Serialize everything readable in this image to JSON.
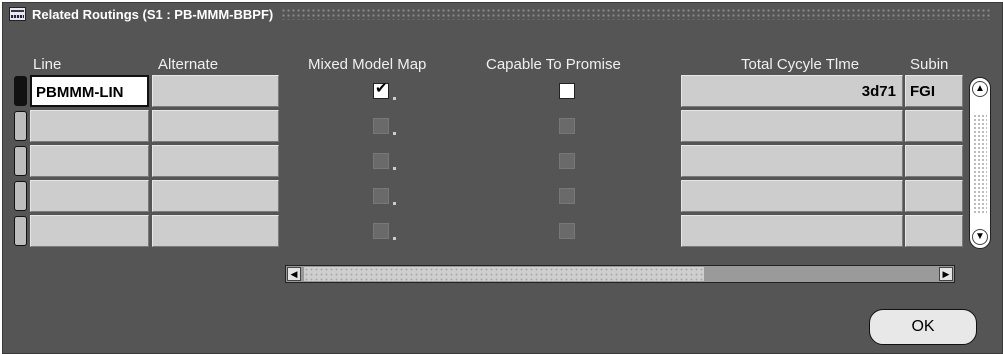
{
  "window": {
    "title": "Related Routings (S1 : PB-MMM-BBPF)"
  },
  "columns": {
    "line": "Line",
    "alternate": "Alternate",
    "mixed_model_map": "Mixed Model Map",
    "capable_to_promise": "Capable To Promise",
    "total_cycle_time": "Total Cycyle Tlme",
    "subinventory": "Subin"
  },
  "rows": [
    {
      "line": "PBMMM-LIN",
      "alternate": "",
      "mixed_model_map": true,
      "capable_to_promise": false,
      "total_cycle_time": "3d71",
      "subinventory": "FGI"
    },
    {
      "line": "",
      "alternate": "",
      "mixed_model_map": false,
      "capable_to_promise": false,
      "total_cycle_time": "",
      "subinventory": ""
    },
    {
      "line": "",
      "alternate": "",
      "mixed_model_map": false,
      "capable_to_promise": false,
      "total_cycle_time": "",
      "subinventory": ""
    },
    {
      "line": "",
      "alternate": "",
      "mixed_model_map": false,
      "capable_to_promise": false,
      "total_cycle_time": "",
      "subinventory": ""
    },
    {
      "line": "",
      "alternate": "",
      "mixed_model_map": false,
      "capable_to_promise": false,
      "total_cycle_time": "",
      "subinventory": ""
    }
  ],
  "buttons": {
    "ok": "OK"
  },
  "icons": {
    "window": "oracle-forms-window-icon",
    "check": "✔",
    "scroll_up": "▲",
    "scroll_down": "▼",
    "scroll_left": "◀",
    "scroll_right": "▶"
  }
}
